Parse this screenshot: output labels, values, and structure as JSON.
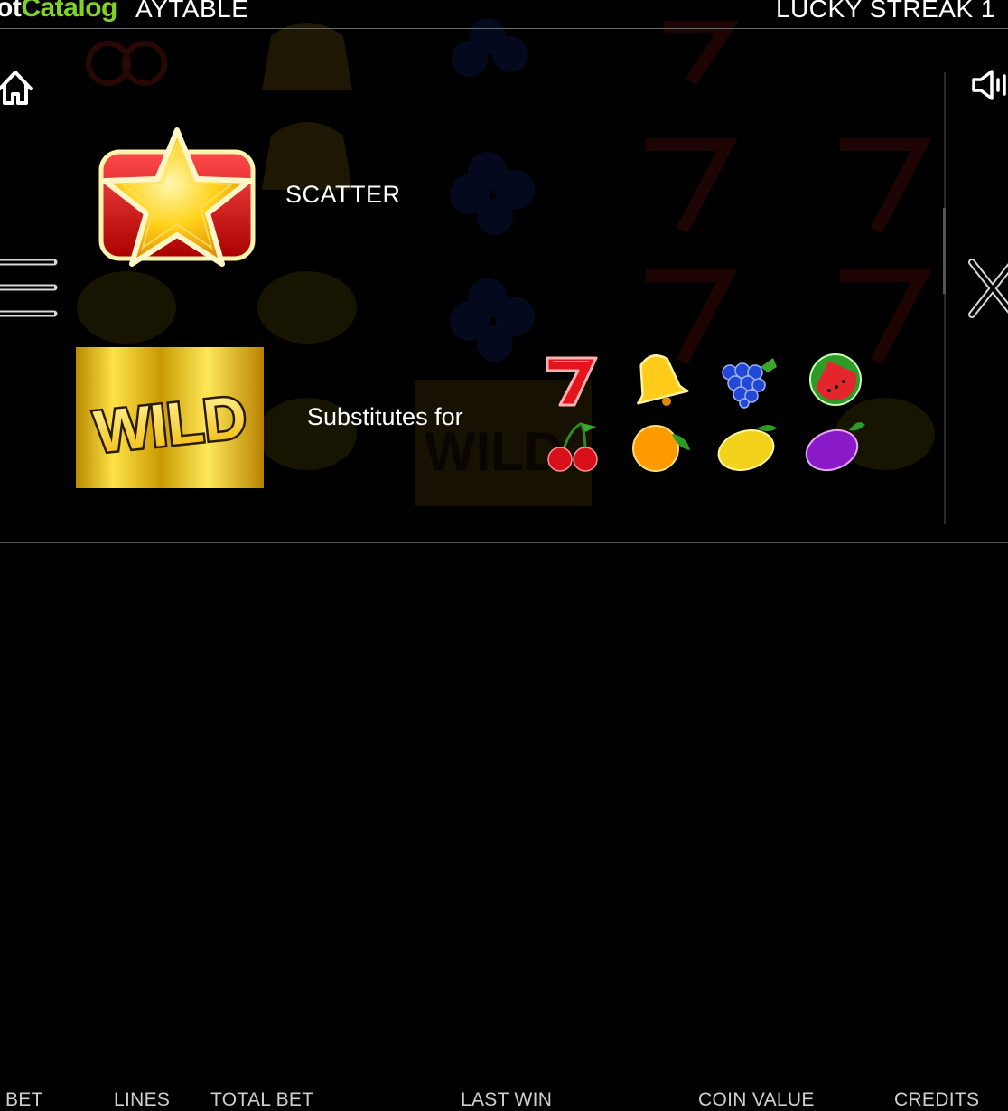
{
  "header": {
    "logo_prefix": "ot",
    "logo_brand": "Catalog",
    "paytable_title": "AYTABLE",
    "game_title": "LUCKY STREAK 1"
  },
  "colors": {
    "background": "#000000",
    "logo_brand": "#7fd321",
    "text": "#ffffff",
    "footer_text": "#cfcfcf"
  },
  "toolbar": {
    "home": "home-icon",
    "sound": "speaker-icon",
    "menu": "hamburger-menu-icon",
    "close": "close-icon"
  },
  "paytable": {
    "scatter": {
      "symbol": "star-scatter",
      "label": "SCATTER"
    },
    "wild": {
      "symbol": "wild",
      "text": "WILD",
      "label": "Substitutes for"
    },
    "substitutes": [
      "seven",
      "bell",
      "grapes",
      "watermelon",
      "cherries",
      "orange",
      "lemon",
      "plum"
    ]
  },
  "footer": {
    "labels": [
      "BET",
      "LINES",
      "TOTAL BET",
      "LAST WIN",
      "COIN VALUE",
      "CREDITS"
    ]
  }
}
